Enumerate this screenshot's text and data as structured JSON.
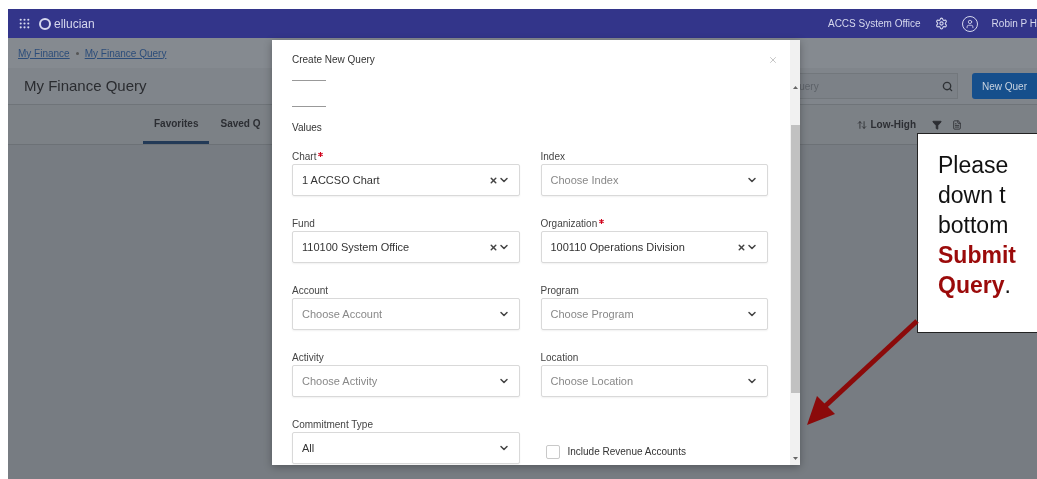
{
  "top_bar": {
    "brand": "ellucian",
    "institution": "ACCS System Office",
    "user": "Robin P H"
  },
  "breadcrumbs": [
    "My Finance",
    "My Finance Query"
  ],
  "page_title": "My Finance Query",
  "tabs": [
    {
      "label": "Favorites",
      "selected": true
    },
    {
      "label": "Saved Q",
      "selected": false
    }
  ],
  "search": {
    "placeholder": "uery"
  },
  "new_button": "New Quer",
  "sort": {
    "label": "Low-High"
  },
  "modal": {
    "title": "Create New Query",
    "section": "Values",
    "fields": [
      {
        "kind": "select",
        "label": "Chart",
        "required": true,
        "value": "1 ACCSO Chart"
      },
      {
        "kind": "select",
        "label": "Index",
        "required": false,
        "placeholder": "Choose Index"
      },
      {
        "kind": "select",
        "label": "Fund",
        "required": false,
        "value": "110100 System Office"
      },
      {
        "kind": "select",
        "label": "Organization",
        "required": true,
        "value": "100110 Operations Division"
      },
      {
        "kind": "select",
        "label": "Account",
        "required": false,
        "placeholder": "Choose Account"
      },
      {
        "kind": "select",
        "label": "Program",
        "required": false,
        "placeholder": "Choose Program"
      },
      {
        "kind": "select",
        "label": "Activity",
        "required": false,
        "placeholder": "Choose Activity"
      },
      {
        "kind": "select",
        "label": "Location",
        "required": false,
        "placeholder": "Choose Location"
      },
      {
        "kind": "select",
        "label": "Commitment Type",
        "required": false,
        "value": "All",
        "clearable": false
      },
      {
        "kind": "checkbox",
        "label": "Include Revenue Accounts",
        "checked": false
      }
    ]
  },
  "callout": {
    "lines": [
      "Please",
      "down t",
      "bottom",
      "**Submit**",
      "**Query**."
    ]
  }
}
